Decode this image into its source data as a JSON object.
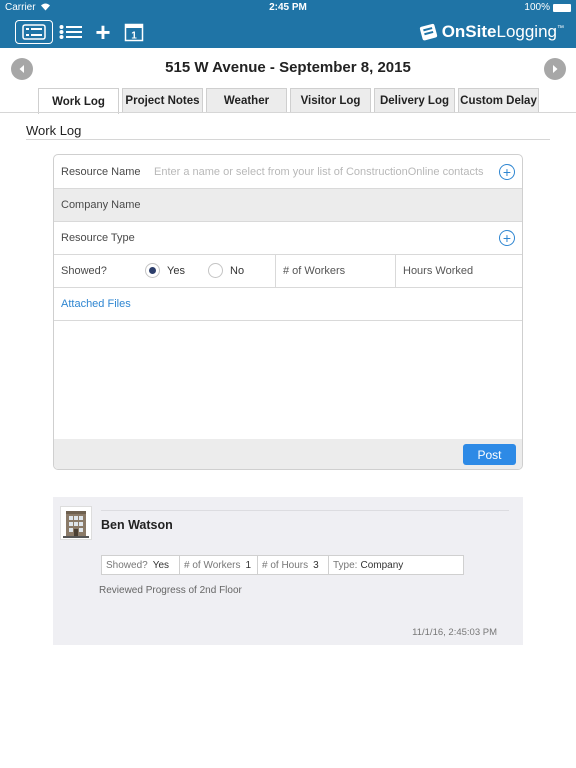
{
  "status_bar": {
    "carrier": "Carrier",
    "time": "2:45 PM",
    "battery": "100%"
  },
  "toolbar": {
    "logo_bold": "OnSite",
    "logo_light": "Logging",
    "logo_tm": "™",
    "add_symbol": "+",
    "calendar_day": "1",
    "accent_color": "#1f74a6"
  },
  "date_nav": {
    "title": "515 W Avenue - September 8, 2015"
  },
  "tabs": [
    {
      "label": "Work Log",
      "active": true
    },
    {
      "label": "Project Notes",
      "active": false
    },
    {
      "label": "Weather",
      "active": false
    },
    {
      "label": "Visitor Log",
      "active": false
    },
    {
      "label": "Delivery Log",
      "active": false
    },
    {
      "label": "Custom Delay",
      "active": false
    }
  ],
  "section": {
    "title": "Work Log"
  },
  "form": {
    "resource_name_label": "Resource Name",
    "resource_name_placeholder": "Enter a name or select from your list of ConstructionOnline contacts",
    "company_name_label": "Company Name",
    "resource_type_label": "Resource Type",
    "showed_label": "Showed?",
    "yes_label": "Yes",
    "no_label": "No",
    "showed_selected": "Yes",
    "workers_placeholder": "# of Workers",
    "hours_placeholder": "Hours Worked",
    "attached_files_label": "Attached Files",
    "post_label": "Post",
    "plus_symbol": "+"
  },
  "entries": [
    {
      "name": "Ben Watson",
      "showed_label": "Showed?",
      "showed_value": "Yes",
      "workers_label": "# of Workers",
      "workers_value": "1",
      "hours_label": "# of Hours",
      "hours_value": "3",
      "type_label": "Type:",
      "type_value": "Company",
      "description": "Reviewed Progress of 2nd Floor",
      "timestamp": "11/1/16, 2:45:03 PM"
    }
  ]
}
